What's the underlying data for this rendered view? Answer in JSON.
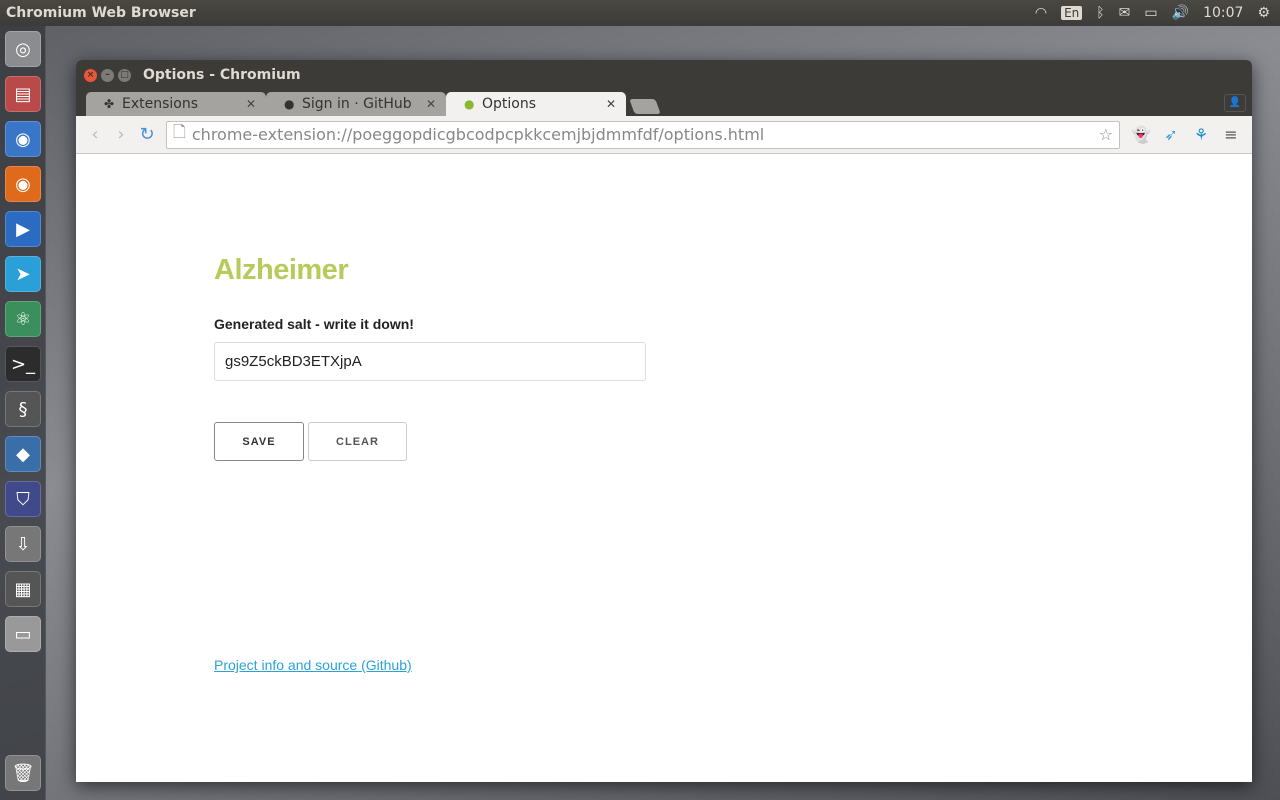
{
  "topbar": {
    "app_name": "Chromium Web Browser",
    "keyboard": "En",
    "clock": "10:07"
  },
  "launcher": [
    {
      "name": "ubuntu-dash-icon",
      "glyph": "◎",
      "color": "#8a8c90"
    },
    {
      "name": "files-icon",
      "glyph": "▤",
      "color": "#b84a4a"
    },
    {
      "name": "chromium-icon",
      "glyph": "◉",
      "color": "#3a76c8"
    },
    {
      "name": "firefox-icon",
      "glyph": "◉",
      "color": "#e06a1c"
    },
    {
      "name": "media-player-icon",
      "glyph": "▶",
      "color": "#2b6cc2"
    },
    {
      "name": "telegram-icon",
      "glyph": "➤",
      "color": "#2a9fd8"
    },
    {
      "name": "atom-icon",
      "glyph": "⚛",
      "color": "#3a8f5c"
    },
    {
      "name": "terminal-icon",
      "glyph": ">_",
      "color": "#2c2c2c"
    },
    {
      "name": "python-icon",
      "glyph": "§",
      "color": "#555"
    },
    {
      "name": "virtualbox-icon",
      "glyph": "◆",
      "color": "#3a6ea8"
    },
    {
      "name": "security-shield-icon",
      "glyph": "⛉",
      "color": "#404a8a"
    },
    {
      "name": "software-updater-icon",
      "glyph": "⇩",
      "color": "#777"
    },
    {
      "name": "workspace-switcher-icon",
      "glyph": "▦",
      "color": "#555"
    },
    {
      "name": "drive-icon",
      "glyph": "▭",
      "color": "#999"
    }
  ],
  "trash": {
    "name": "trash-icon",
    "glyph": "🗑",
    "color": "#777"
  },
  "window": {
    "title": "Options - Chromium"
  },
  "tabs": [
    {
      "label": "Extensions",
      "icon": "puzzle-icon"
    },
    {
      "label": "Sign in · GitHub",
      "icon": "github-icon"
    },
    {
      "label": "Options",
      "icon": "extension-lock-icon",
      "active": true
    }
  ],
  "address": {
    "url": "chrome-extension://poeggopdicgbcodpcpkkcemjbjdmmfdf/options.html"
  },
  "page": {
    "title": "Alzheimer",
    "salt_label": "Generated salt - write it down!",
    "salt_value": "gs9Z5ckBD3ETXjpA",
    "save_label": "SAVE",
    "clear_label": "CLEAR",
    "link": "Project info and source (Github)",
    "accent": "#b5cc5a",
    "link_color": "#2aa3d8"
  }
}
